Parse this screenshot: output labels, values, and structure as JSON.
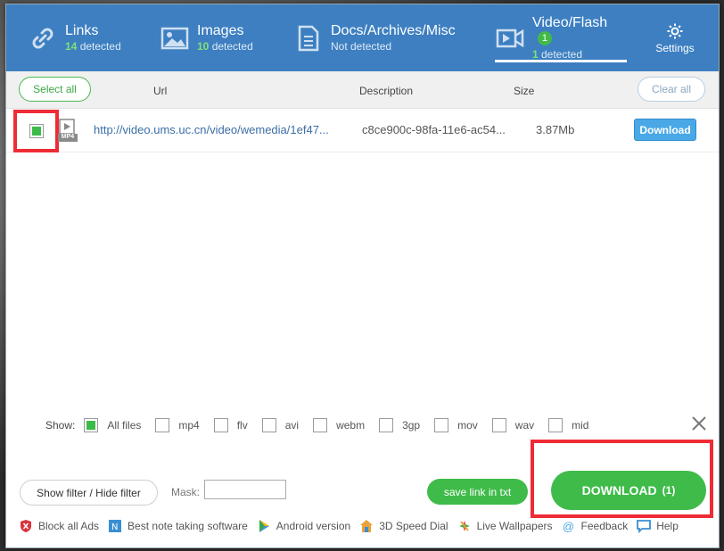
{
  "tabs": [
    {
      "title": "Links",
      "count": "14",
      "status": "detected"
    },
    {
      "title": "Images",
      "count": "10",
      "status": "detected"
    },
    {
      "title": "Docs/Archives/Misc",
      "status": "Not detected"
    },
    {
      "title": "Video/Flash",
      "badge": "1",
      "count": "1",
      "status": "detected"
    }
  ],
  "settings_label": "Settings",
  "toolbar": {
    "select_all": "Select all",
    "clear_all": "Clear all",
    "col_url": "Url",
    "col_description": "Description",
    "col_size": "Size"
  },
  "files": [
    {
      "type_label": "MP4",
      "url": "http://video.ums.uc.cn/video/wemedia/1ef47...",
      "description": "c8ce900c-98fa-11e6-ac54...",
      "size": "3.87Mb",
      "download_label": "Download",
      "checked": true
    }
  ],
  "filter": {
    "label": "Show:",
    "options": [
      {
        "label": "All files",
        "checked": true
      },
      {
        "label": "mp4",
        "checked": false
      },
      {
        "label": "flv",
        "checked": false
      },
      {
        "label": "avi",
        "checked": false
      },
      {
        "label": "webm",
        "checked": false
      },
      {
        "label": "3gp",
        "checked": false
      },
      {
        "label": "mov",
        "checked": false
      },
      {
        "label": "wav",
        "checked": false
      },
      {
        "label": "mid",
        "checked": false
      }
    ]
  },
  "bottom": {
    "filter_toggle": "Show filter / Hide filter",
    "mask_label": "Mask:",
    "mask_value": "",
    "save_link": "save link in txt",
    "download_label": "DOWNLOAD",
    "download_count": "(1)"
  },
  "footer": [
    {
      "label": "Block all Ads",
      "icon": "shield-icon"
    },
    {
      "label": "Best note taking software",
      "icon": "note-icon"
    },
    {
      "label": "Android version",
      "icon": "play-store-icon"
    },
    {
      "label": "3D Speed Dial",
      "icon": "house-icon"
    },
    {
      "label": "Live Wallpapers",
      "icon": "wallpaper-icon"
    },
    {
      "label": "Feedback",
      "icon": "at-icon"
    },
    {
      "label": "Help",
      "icon": "chat-icon"
    }
  ],
  "colors": {
    "header": "#3d7fc1",
    "accent_green": "#3fbb4a",
    "download_blue": "#4aa8e6",
    "highlight_red": "#ee2b36"
  }
}
